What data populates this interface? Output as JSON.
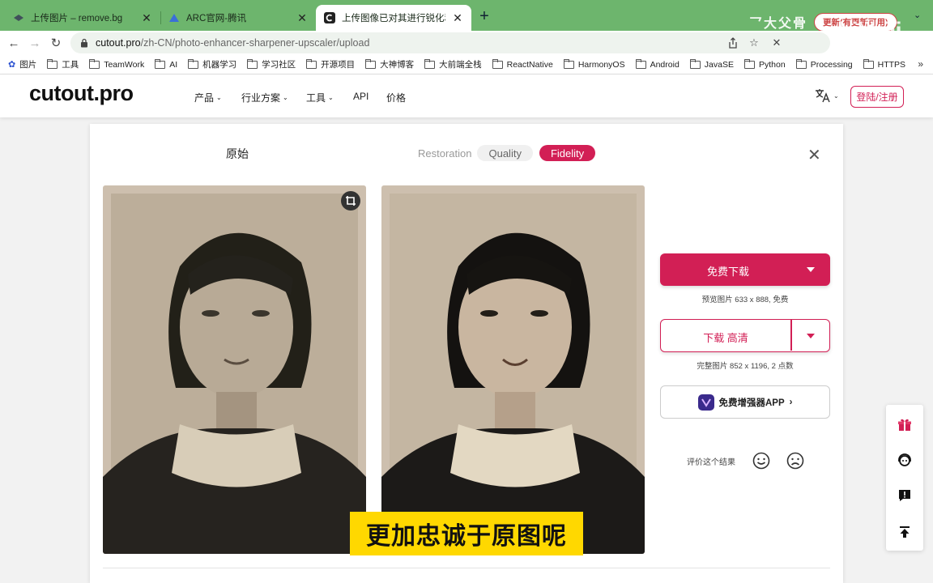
{
  "browser": {
    "tabs": [
      {
        "title": "上传图片 – remove.bg",
        "active": false
      },
      {
        "title": "ARC官网-腾讯",
        "active": false
      },
      {
        "title": "上传图像已对其进行锐化和放大",
        "active": true
      }
    ],
    "url_host": "cutout.pro",
    "url_path": "/zh-CN/photo-enhancer-sharpener-upscaler/upload",
    "bookmarks": [
      "图片",
      "工具",
      "TeamWork",
      "AI",
      "机器学习",
      "学习社区",
      "开源项目",
      "大神博客",
      "大前端全栈",
      "ReactNative",
      "HarmonyOS",
      "Android",
      "JavaSE",
      "Python",
      "Processing",
      "HTTPS"
    ],
    "overlay_text": "更新(有更新可用)"
  },
  "site": {
    "logo": "cutout.pro",
    "nav": [
      {
        "label": "产品",
        "dropdown": true
      },
      {
        "label": "行业方案",
        "dropdown": true
      },
      {
        "label": "工具",
        "dropdown": true
      },
      {
        "label": "API",
        "dropdown": false
      },
      {
        "label": "价格",
        "dropdown": false
      }
    ],
    "login_label": "登陆/注册"
  },
  "editor": {
    "original_label": "原始",
    "modes": [
      "Restoration",
      "Quality",
      "Fidelity"
    ],
    "active_mode": "Fidelity",
    "free_download_label": "免费下载",
    "preview_info": "预览图片 633 x 888, 免费",
    "hd_download_label": "下载 高清",
    "full_info": "完整图片 852 x 1196, 2 点数",
    "app_label": "免费增强器APP",
    "rate_label": "评价这个结果"
  },
  "subtitle": "更加忠诚于原图呢",
  "colors": {
    "accent": "#d21f55",
    "tab_strip": "#6db56d",
    "subtitle_bg": "#ffd800"
  }
}
